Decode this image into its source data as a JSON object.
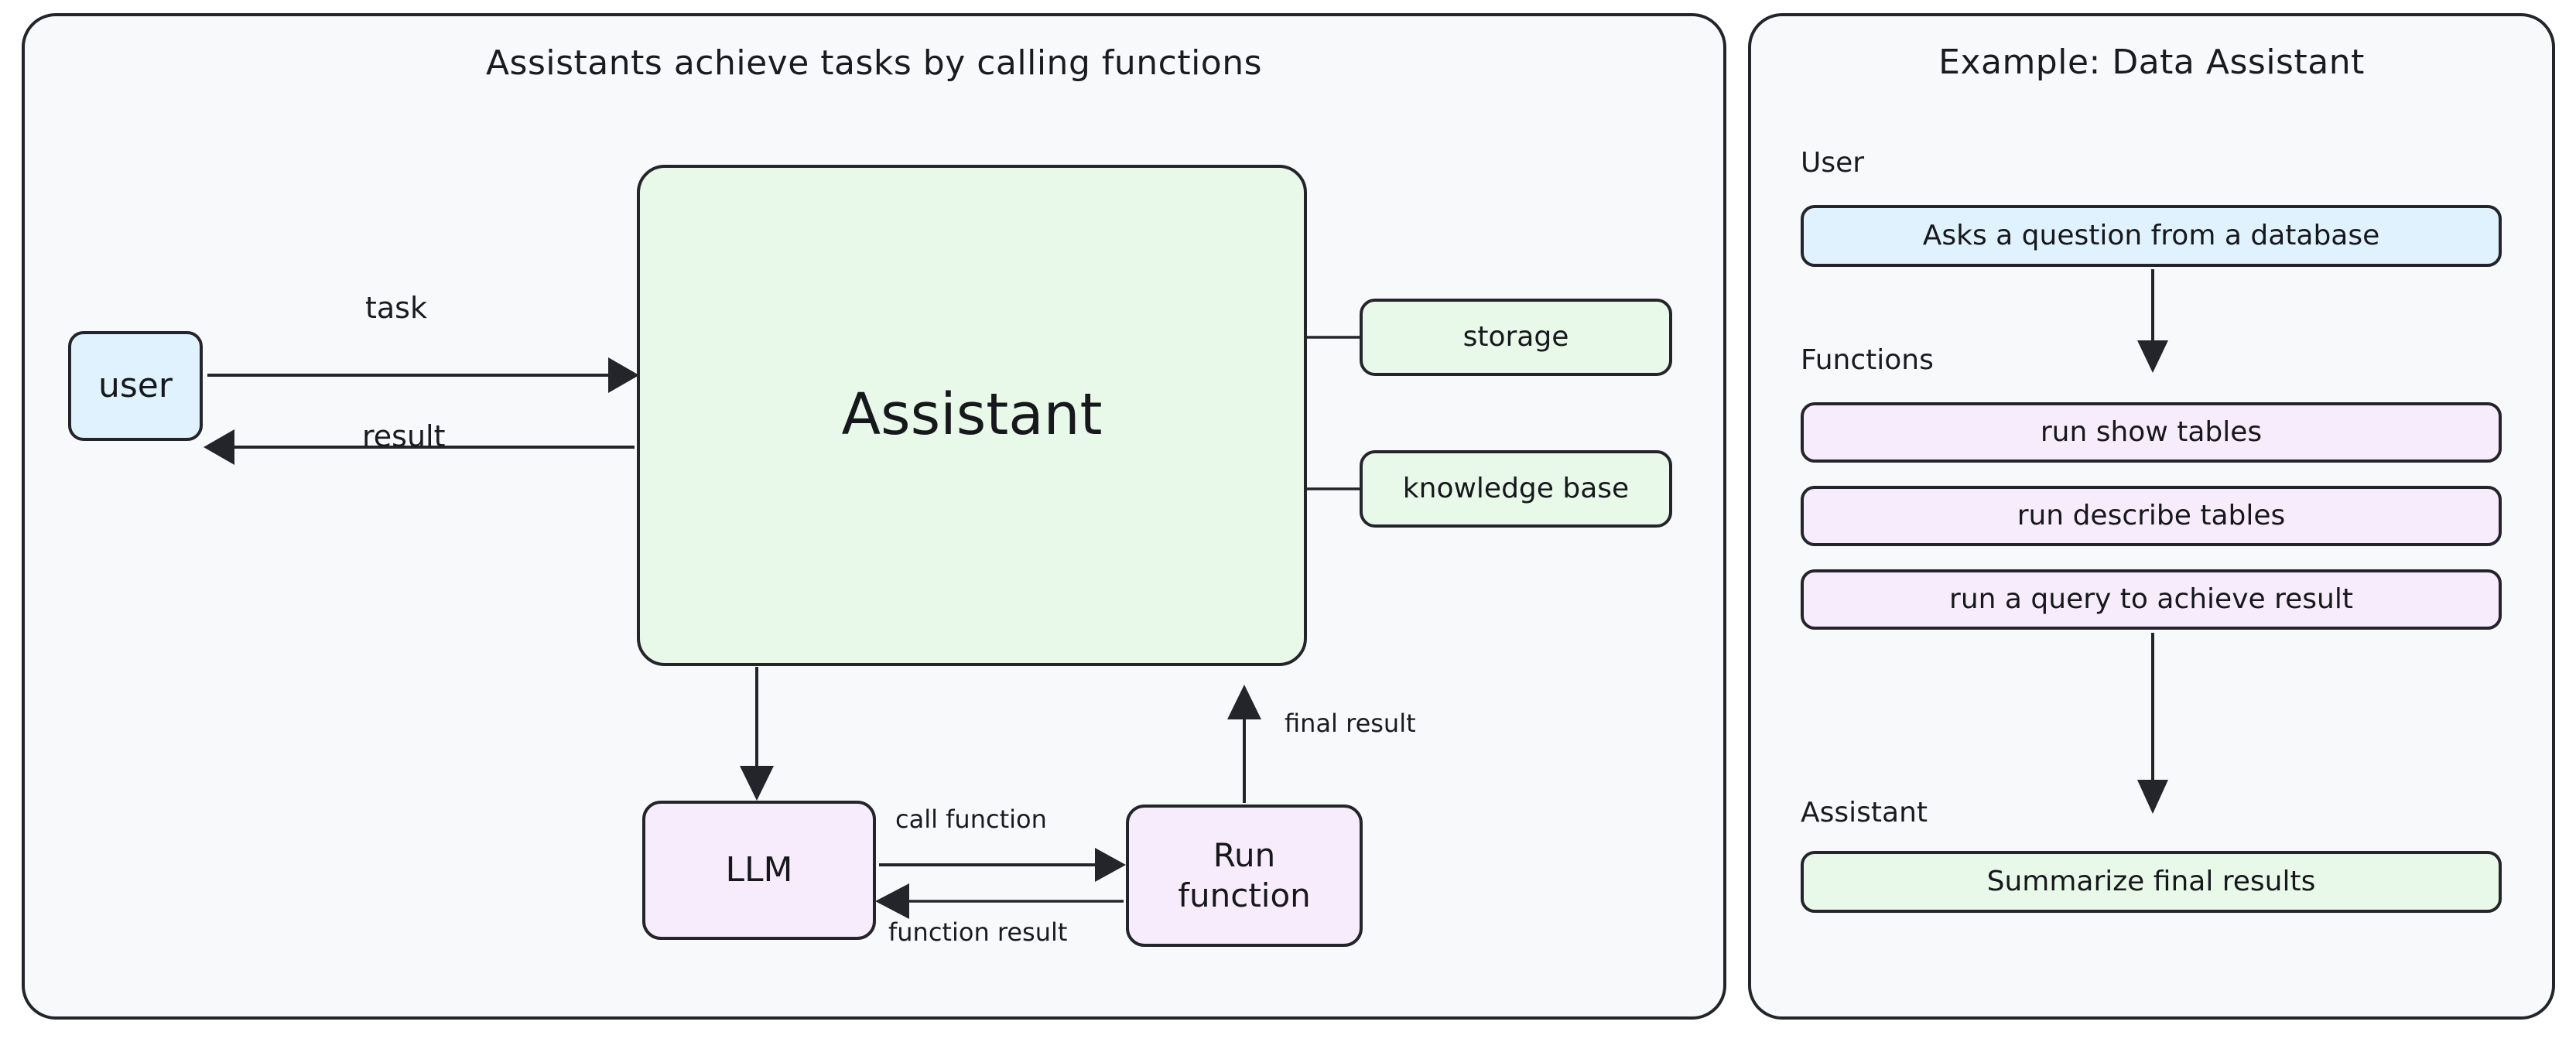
{
  "left_panel": {
    "title": "Assistants achieve tasks by calling functions",
    "nodes": {
      "user": "user",
      "assistant": "Assistant",
      "storage": "storage",
      "knowledge_base": "knowledge base",
      "llm": "LLM",
      "run_function_line1": "Run",
      "run_function_line2": "function"
    },
    "edge_labels": {
      "task": "task",
      "result": "result",
      "call_function": "call function",
      "function_result": "function result",
      "final_result": "final result"
    }
  },
  "right_panel": {
    "title": "Example: Data Assistant",
    "sections": {
      "user_label": "User",
      "functions_label": "Functions",
      "assistant_label": "Assistant"
    },
    "user_step": "Asks a question from a database",
    "functions": [
      "run show tables",
      "run describe tables",
      "run a query to achieve result"
    ],
    "assistant_step": "Summarize final results"
  },
  "colors": {
    "panel_background": "#f7f9fb",
    "stroke": "#23252a",
    "fill_blue": "#e0f2fd",
    "fill_green": "#e8f8e9",
    "fill_purple": "#f7ecfb",
    "text": "#16181c"
  }
}
